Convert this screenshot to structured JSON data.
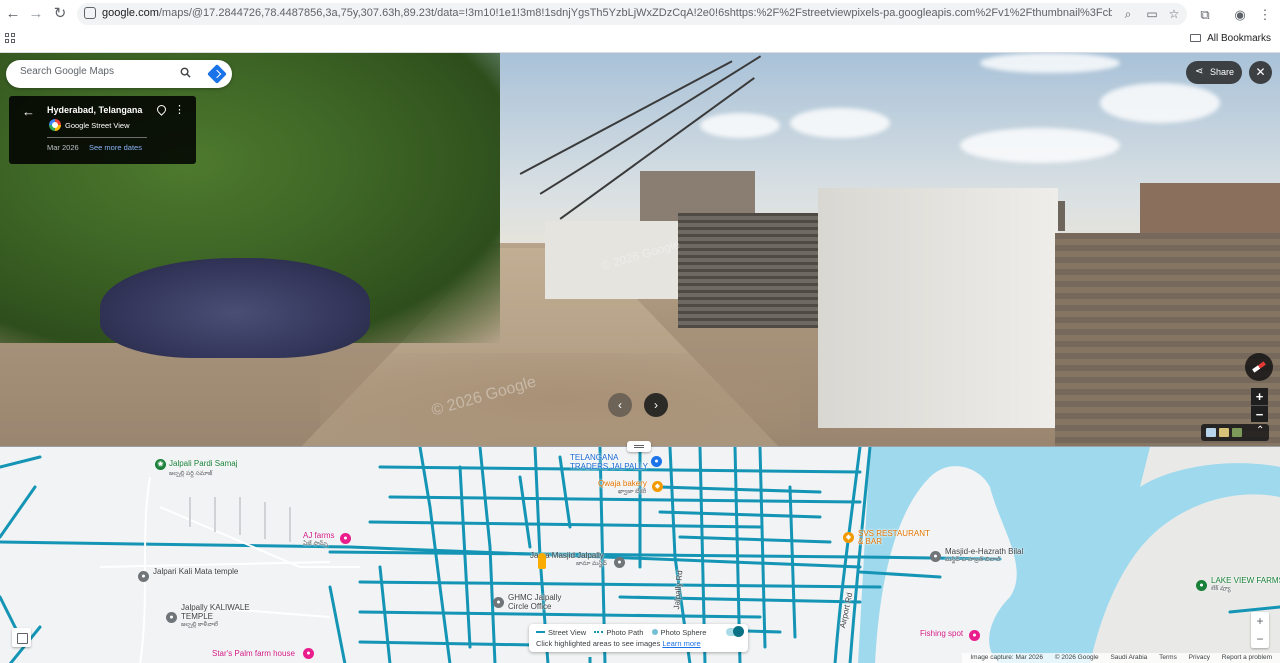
{
  "browser": {
    "url_host": "google.com",
    "url_rest": "/maps/@17.2844726,78.4487856,3a,75y,307.63h,89.23t/data=!3m10!1e1!3m8!1sdnjYgsTh5YzbLjWxZDzCqA!2e0!6shttps:%2F%2Fstreetviewpixels-pa.googleapis.com%2Fv1%2Fthumbnail%3Fcb_client%3Dmaps_sv.tactile%26w%3D900...",
    "bookmarks_label": "All Bookmarks"
  },
  "search": {
    "placeholder": "Search Google Maps"
  },
  "info_card": {
    "title": "Hyderabad, Telangana",
    "provider": "Google Street View",
    "date": "Mar 2026",
    "more_dates": "See more dates"
  },
  "street_view": {
    "share_label": "Share",
    "watermark": "© 2026 Google"
  },
  "map": {
    "pois": [
      {
        "name": "Jalpali Pardi Samaj",
        "sub": "జల్పల్లి పర్ది సమాజ్",
        "color": "#188038"
      },
      {
        "name": "TELANGANA\nTRADERS JALPALLY",
        "sub": "",
        "color": "#1967d2"
      },
      {
        "name": "Qwaja bakery",
        "sub": "ఖ్వాజా బేకరీ",
        "color": "#e37400"
      },
      {
        "name": "AJ farms",
        "sub": "ఏజే ఫామ్స్",
        "color": "#d01884"
      },
      {
        "name": "Jalpari Kali Mata temple",
        "sub": "",
        "color": "#3c4043"
      },
      {
        "name": "Jama Masjid Jalpally",
        "sub": "జామా మస్జిద్",
        "color": "#3c4043"
      },
      {
        "name": "GHMC Jalpally\nCircle Office",
        "sub": "",
        "color": "#3c4043"
      },
      {
        "name": "Jalpally KALIWALE\nTEMPLE",
        "sub": "జల్పల్లి కాళీవాలే",
        "color": "#3c4043"
      },
      {
        "name": "SVS RESTAURANT\n& BAR",
        "sub": "",
        "color": "#e37400"
      },
      {
        "name": "Masjid-e-Hazrath Bilal",
        "sub": "మస్జిద్-ఎ-హజ్రత్ బిలాల్",
        "color": "#3c4043"
      },
      {
        "name": "LAKE VIEW FARMS",
        "sub": "లేక్ వ్యూ",
        "color": "#188038"
      },
      {
        "name": "Fishing spot",
        "sub": "",
        "color": "#d01884"
      },
      {
        "name": "Star's Palm farm house",
        "sub": "",
        "color": "#d01884"
      }
    ],
    "roads": [
      "Airport Rd",
      "Jalpally Rd"
    ],
    "legend": {
      "street_view": "Street View",
      "photo_path": "Photo Path",
      "photo_sphere": "Photo Sphere",
      "hint": "Click highlighted areas to see images",
      "learn_more": "Learn more"
    },
    "attribution": [
      "Image capture: Mar 2026",
      "© 2026 Google",
      "Saudi Arabia",
      "Terms",
      "Privacy",
      "Report a problem"
    ]
  },
  "icons": {
    "back": "arrow-left-icon",
    "forward": "arrow-right-icon",
    "reload": "reload-icon",
    "search": "search-icon",
    "directions": "directions-icon",
    "pin": "pin-icon",
    "more": "more-vert-icon",
    "share": "share-icon",
    "close": "close-icon"
  },
  "colors": {
    "street_view_line": "#1595b5",
    "water": "#9ed9ed",
    "link": "#1a73e8",
    "accent_link_dark": "#8ab4f8"
  }
}
